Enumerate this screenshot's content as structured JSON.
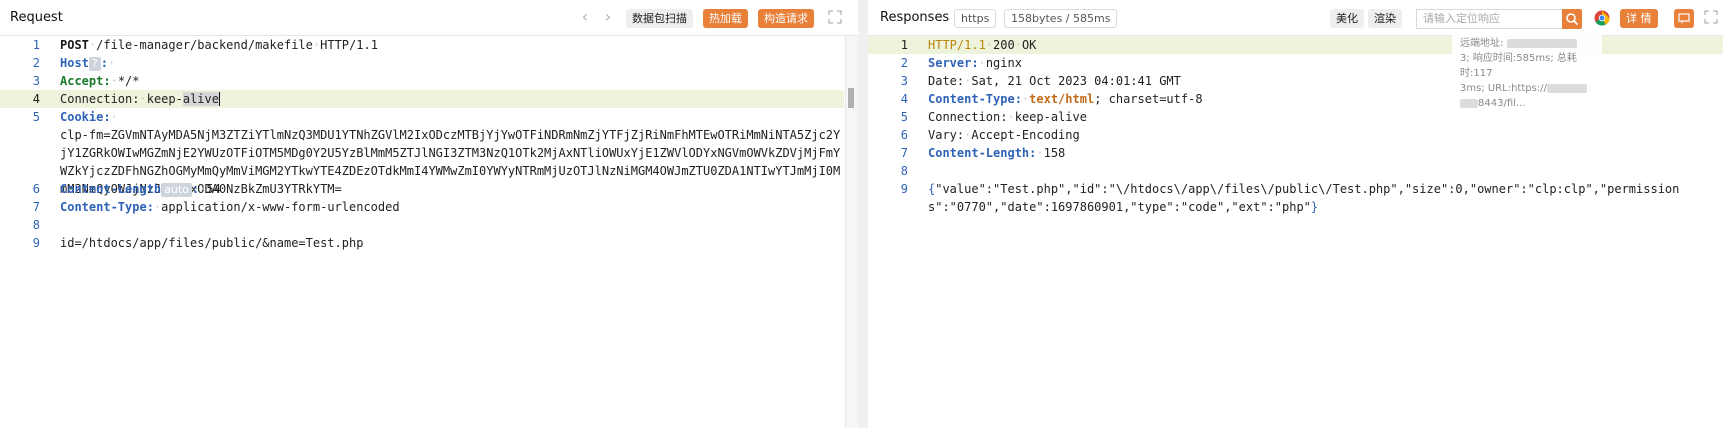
{
  "request": {
    "title": "Request",
    "buttons": {
      "scan": "数据包扫描",
      "hot_load": "热加载",
      "build": "构造请求"
    },
    "lines": [
      {
        "n": "1",
        "method": "POST",
        "path": "/file-manager/backend/makefile",
        "version": "HTTP/1.1"
      },
      {
        "n": "2",
        "key": "Host",
        "badge": "?",
        "value": ""
      },
      {
        "n": "3",
        "key": "Accept:",
        "value": "*/*"
      },
      {
        "n": "4",
        "key": "Connection:",
        "value_pre": "keep-",
        "value_sel": "alive"
      },
      {
        "n": "5",
        "key": "Cookie:",
        "value": ""
      },
      {
        "n": "",
        "value": "clp-fm=ZGVmNTAyMDA5NjM3ZTZiYTlmNzQ3MDU1YTNhZGVlM2IxODczMTBjYjYwOTFiNDRmNmZjYTFjZjRiNmFhMTEwOTRiMmNiNTA5Zjc2YjY1ZGRkOWIwMGZmNjE2YWUzOTFiOTM5MDg0Y2U5YzBlMmM5ZTJlNGI3ZTM3NzQ1OTk2MjAxNTliOWUxYjE1ZWVlODYxNGVmOWVkZDVjMjFmYWZkYjczZDFhNGZhOGMyMmQyMmViMGM2YTkwYTE4ZDEzOTdkMmI4YWMwZmI0YWYyNTRmMjUzOTJlNzNiMGM4OWJmZTU0ZDA1NTIwYTJmMjI0MmM2NmQyOWJjNzJlZGExODA0NzBkZmU3YTRkYTM="
      },
      {
        "n": "6",
        "key": "Content-Length",
        "badge": "auto",
        "value": "54"
      },
      {
        "n": "7",
        "key": "Content-Type:",
        "value": "application/x-www-form-urlencoded"
      },
      {
        "n": "8",
        "value": ""
      },
      {
        "n": "9",
        "value": "id=/htdocs/app/files/public/&name=Test.php"
      }
    ]
  },
  "response": {
    "title": "Responses",
    "protocol_badge": "https",
    "size_badge": "158bytes / 585ms",
    "buttons": {
      "beautify": "美化",
      "render": "渲染",
      "details": "详 情"
    },
    "search_placeholder": "请输入定位响应",
    "tooltip": {
      "remote_label": "远端地址:",
      "timing": "3; 响应时间:585ms; 总耗时:117",
      "url": "3ms; URL:https://",
      "port": "8443/fil..."
    },
    "lines": [
      {
        "n": "1",
        "version": "HTTP/1.1",
        "status": "200",
        "reason": "OK"
      },
      {
        "n": "2",
        "key": "Server:",
        "value": "nginx"
      },
      {
        "n": "3",
        "key": "Date:",
        "value": "Sat, 21 Oct 2023 04:01:41 GMT"
      },
      {
        "n": "4",
        "key": "Content-Type:",
        "value_type": "text/html",
        "value_rest": "; charset=utf-8"
      },
      {
        "n": "5",
        "key": "Connection:",
        "value": "keep-alive"
      },
      {
        "n": "6",
        "key": "Vary:",
        "value": "Accept-Encoding"
      },
      {
        "n": "7",
        "key": "Content-Length:",
        "value": "158"
      },
      {
        "n": "8",
        "value": ""
      },
      {
        "n": "9",
        "value": "{\"value\":\"Test.php\",\"id\":\"\\/htdocs\\/app\\/files\\/public\\/Test.php\",\"size\":0,\"owner\":\"clp:clp\",\"permissions\":\"0770\",\"date\":1697860901,\"type\":\"code\",\"ext\":\"php\"}"
      }
    ]
  },
  "colors": {
    "accent": "#e8803a",
    "line_number": "#2f63b8",
    "header_key_green": "#1b7a2a",
    "active_line_bg": "#eef3dc"
  },
  "icons": [
    "chevron-left-icon",
    "chevron-right-icon",
    "expand-icon",
    "search-icon",
    "chrome-icon",
    "comment-icon"
  ]
}
